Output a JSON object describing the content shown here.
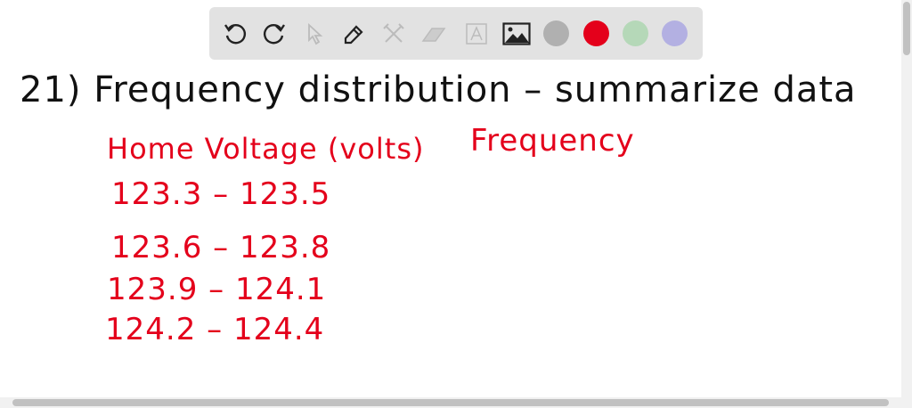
{
  "toolbar": {
    "tools": [
      "undo-icon",
      "redo-icon",
      "select-icon",
      "pen-icon",
      "tools-icon",
      "eraser-icon",
      "text-icon",
      "image-icon"
    ],
    "colors": {
      "gray": "#b0b0b0",
      "red": "#e4001b",
      "green": "#b5d8b8",
      "purple": "#b3b0e2"
    }
  },
  "board": {
    "title": "21)  Frequency distribution – summarize data",
    "col1_header": "Home Voltage (volts)",
    "col2_header": "Frequency",
    "rows": [
      "123.3 – 123.5",
      "123.6 – 123.8",
      "123.9 – 124.1",
      "124.2 – 124.4"
    ]
  }
}
